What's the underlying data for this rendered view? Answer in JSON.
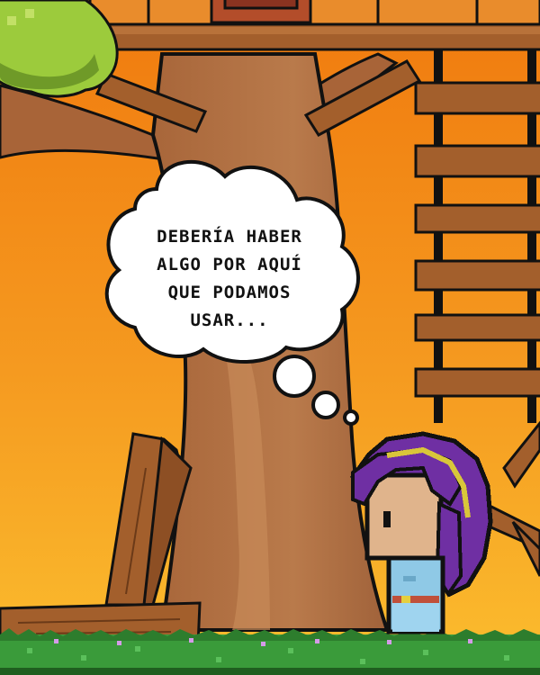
{
  "dialogue": {
    "lines": [
      "DEBERÍA HABER",
      "ALGO POR AQUÍ",
      "QUE PODAMOS",
      "USAR..."
    ]
  },
  "colors": {
    "sky_top": "#f27a0c",
    "sky_bottom": "#fbb52a",
    "trunk": "#b47345",
    "trunk_shadow": "#9b5c33",
    "wood": "#a35f2c",
    "wood_light": "#b8723a",
    "house": "#e98c2c",
    "leaves": "#9ccb3c",
    "grass": "#3a9b3a",
    "hair": "#6f2fa3",
    "skin": "#e0b48c",
    "shirt": "#8fc9e6",
    "outline": "#111111"
  }
}
